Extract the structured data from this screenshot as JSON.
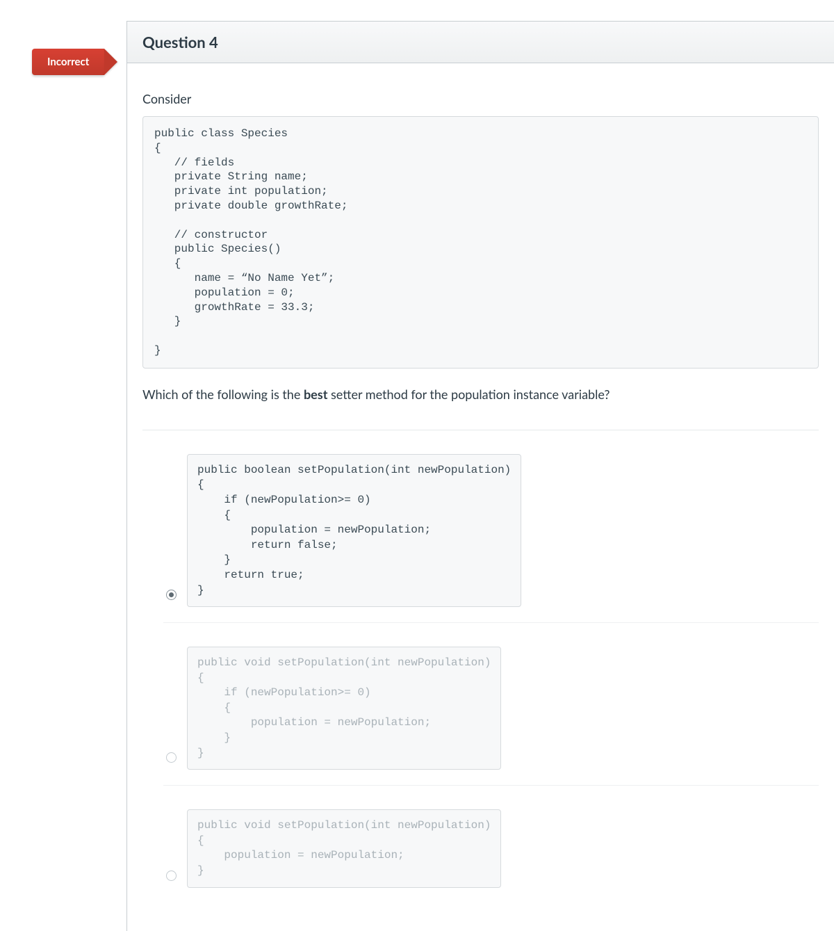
{
  "badge": {
    "label": "Incorrect"
  },
  "header": {
    "title": "Question 4"
  },
  "body": {
    "intro": "Consider",
    "code": "public class Species\n{\n   // fields\n   private String name;\n   private int population;\n   private double growthRate;\n\n   // constructor\n   public Species()\n   {\n      name = “No Name Yet”;\n      population = 0;\n      growthRate = 33.3;\n   }\n\n}",
    "stem_before": "Which of the following is the ",
    "stem_bold": "best",
    "stem_after": " setter method for the population instance variable?"
  },
  "answers": [
    {
      "selected": true,
      "code": "public boolean setPopulation(int newPopulation)\n{\n    if (newPopulation>= 0)\n    {\n        population = newPopulation;\n        return false;\n    }\n    return true;\n}"
    },
    {
      "selected": false,
      "code": "public void setPopulation(int newPopulation)\n{\n    if (newPopulation>= 0)\n    {\n        population = newPopulation;\n    }\n}"
    },
    {
      "selected": false,
      "code": "public void setPopulation(int newPopulation)\n{\n    population = newPopulation;\n}"
    }
  ]
}
